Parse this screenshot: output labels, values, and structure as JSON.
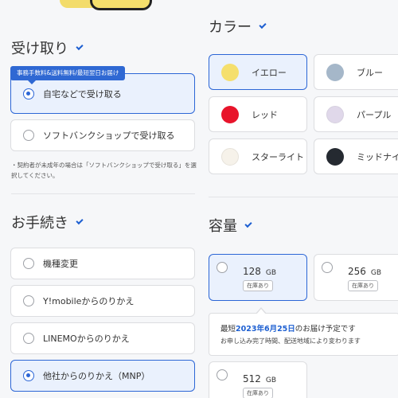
{
  "receive": {
    "title": "受け取り",
    "badge": "事務手数料&送料無料/最短翌日お届け",
    "options": [
      {
        "label": "自宅などで受け取る",
        "selected": true
      },
      {
        "label": "ソフトバンクショップで受け取る",
        "selected": false
      }
    ],
    "note": "・契約者が未成年の場合は「ソフトバンクショップで受け取る」を選択してください。"
  },
  "procedure": {
    "title": "お手続き",
    "options": [
      {
        "label": "機種変更",
        "selected": false
      },
      {
        "label": "Y!mobileからのりかえ",
        "selected": false
      },
      {
        "label": "LINEMOからのりかえ",
        "selected": false
      },
      {
        "label": "他社からのりかえ（MNP）",
        "selected": true
      }
    ]
  },
  "color": {
    "title": "カラー",
    "options": [
      {
        "label": "イエロー",
        "swatch": "#f5df6d",
        "selected": true
      },
      {
        "label": "ブルー",
        "swatch": "#a5b7c9",
        "selected": false
      },
      {
        "label": "レッド",
        "swatch": "#e8142b",
        "selected": false
      },
      {
        "label": "パープル",
        "swatch": "#e0d8ea",
        "selected": false
      },
      {
        "label": "スターライト",
        "swatch": "#f6f2ea",
        "selected": false
      },
      {
        "label": "ミッドナイト",
        "swatch": "#252a31",
        "selected": false
      }
    ]
  },
  "capacity": {
    "title": "容量",
    "options": [
      {
        "size": "128",
        "unit": "GB",
        "stock": "在庫あり",
        "selected": true
      },
      {
        "size": "256",
        "unit": "GB",
        "stock": "在庫あり",
        "selected": false
      },
      {
        "size": "512",
        "unit": "GB",
        "stock": "在庫あり",
        "selected": false
      }
    ],
    "delivery": {
      "prefix": "最短",
      "date": "2023年6月25日",
      "suffix": "のお届け予定です",
      "sub": "お申し込み完了時間、配送地域により変わります"
    }
  },
  "colors": {
    "accent": "#2c66d6",
    "selected_bg": "#eaf1fd",
    "badge": "#2f68d3"
  }
}
